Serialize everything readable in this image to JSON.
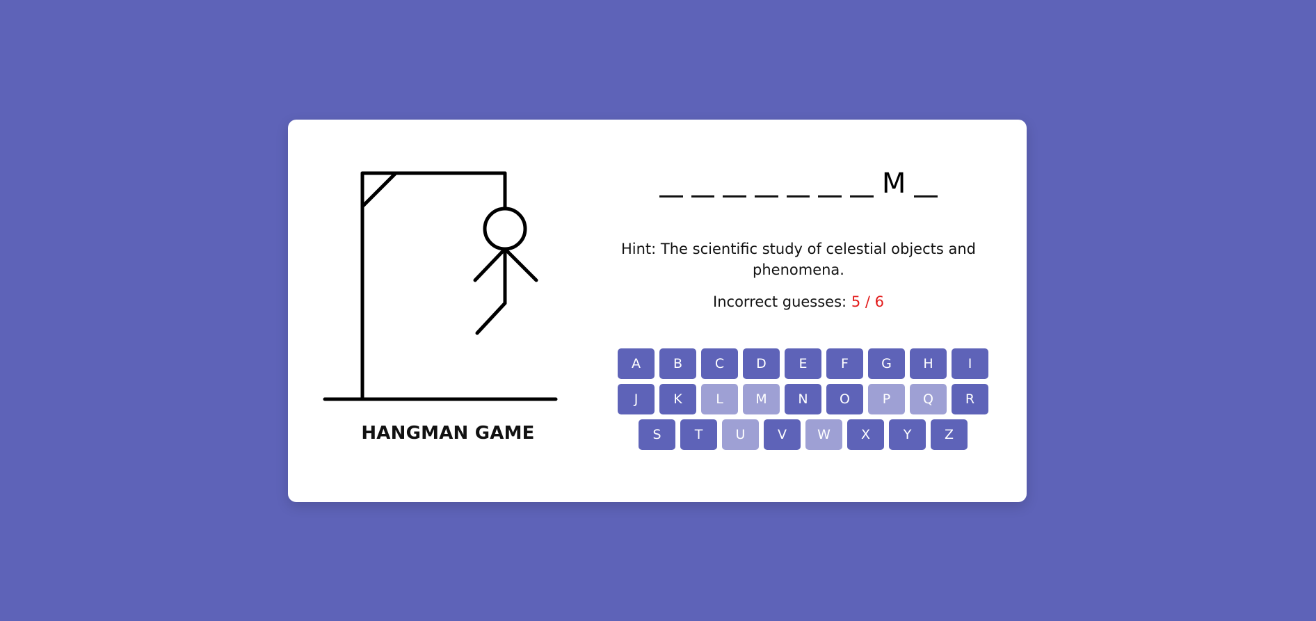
{
  "game": {
    "title": "HANGMAN GAME",
    "hint_label": "Hint:",
    "hint_text": "The scientific study of celestial objects and phenomena.",
    "guesses_label": "Incorrect guesses:",
    "guesses_count": "5 / 6",
    "incorrect_guesses": 5,
    "max_guesses": 6
  },
  "word": {
    "letters": [
      "",
      "",
      "",
      "",
      "",
      "",
      "",
      "M",
      ""
    ]
  },
  "keyboard": {
    "rows": [
      [
        {
          "letter": "A",
          "disabled": false
        },
        {
          "letter": "B",
          "disabled": false
        },
        {
          "letter": "C",
          "disabled": false
        },
        {
          "letter": "D",
          "disabled": false
        },
        {
          "letter": "E",
          "disabled": false
        },
        {
          "letter": "F",
          "disabled": false
        },
        {
          "letter": "G",
          "disabled": false
        },
        {
          "letter": "H",
          "disabled": false
        },
        {
          "letter": "I",
          "disabled": false
        }
      ],
      [
        {
          "letter": "J",
          "disabled": false
        },
        {
          "letter": "K",
          "disabled": false
        },
        {
          "letter": "L",
          "disabled": true
        },
        {
          "letter": "M",
          "disabled": true
        },
        {
          "letter": "N",
          "disabled": false
        },
        {
          "letter": "O",
          "disabled": false
        },
        {
          "letter": "P",
          "disabled": true
        },
        {
          "letter": "Q",
          "disabled": true
        },
        {
          "letter": "R",
          "disabled": false
        }
      ],
      [
        {
          "letter": "S",
          "disabled": false
        },
        {
          "letter": "T",
          "disabled": false
        },
        {
          "letter": "U",
          "disabled": true
        },
        {
          "letter": "V",
          "disabled": false
        },
        {
          "letter": "W",
          "disabled": true
        },
        {
          "letter": "X",
          "disabled": false
        },
        {
          "letter": "Y",
          "disabled": false
        },
        {
          "letter": "Z",
          "disabled": false
        }
      ]
    ]
  },
  "colors": {
    "background": "#5e63b8",
    "key_active": "#5e63b8",
    "key_disabled": "#9ea0d4",
    "incorrect_count": "#e21b1b"
  }
}
